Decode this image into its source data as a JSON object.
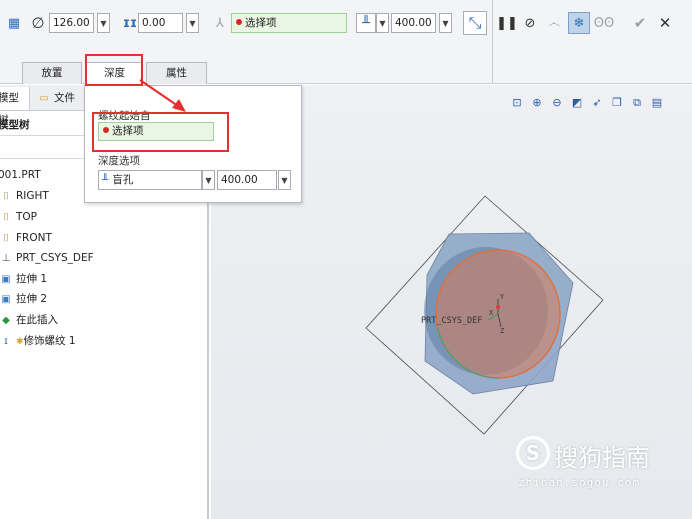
{
  "toolbar": {
    "diameter_value": "126.00",
    "pitch_value": "0.00",
    "reference_label": "选择项",
    "depth_value": "400.00"
  },
  "tabs": [
    "放置",
    "深度",
    "属性"
  ],
  "left_panel": {
    "tab_model_tree": "模型树",
    "tab_files": "文件",
    "title": "模型树",
    "tree": [
      {
        "label": "001.PRT",
        "icon": "part-icon"
      },
      {
        "label": "RIGHT",
        "icon": "datum-plane-icon"
      },
      {
        "label": "TOP",
        "icon": "datum-plane-icon"
      },
      {
        "label": "FRONT",
        "icon": "datum-plane-icon"
      },
      {
        "label": "PRT_CSYS_DEF",
        "icon": "csys-icon"
      },
      {
        "label": "拉伸 1",
        "icon": "extrude-icon"
      },
      {
        "label": "拉伸 2",
        "icon": "extrude-icon"
      },
      {
        "label": "在此插入",
        "icon": "insert-here-icon"
      },
      {
        "label": "修饰螺纹 1",
        "icon": "cosmetic-thread-icon"
      }
    ]
  },
  "depth_panel": {
    "thread_start_label": "螺纹起始自",
    "thread_start_value": "选择项",
    "depth_options_label": "深度选项",
    "depth_type": "盲孔",
    "depth_value": "400.00"
  },
  "viewport": {
    "csys_label": "PRT_CSYS_DEF",
    "axis_x": "X",
    "axis_y": "Y",
    "axis_z": "Z"
  },
  "watermark": {
    "brand": "搜狗指南",
    "url": "zhinan.sogou.com"
  },
  "colors": {
    "highlight_red": "#e43030",
    "reference_green_bg": "#eaf6e4",
    "thread_orange": "#e0703a",
    "model_blue": "#8ea6c6"
  }
}
